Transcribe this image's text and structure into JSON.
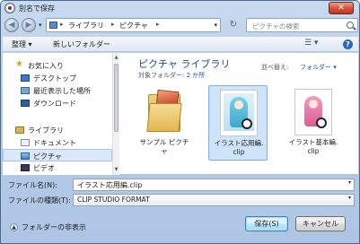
{
  "window": {
    "title": "別名で保存"
  },
  "titlebar": {
    "close_label": "✕"
  },
  "nav": {
    "back_glyph": "◀",
    "forward_glyph": "▶",
    "breadcrumb": [
      "ライブラリ",
      "ピクチャ"
    ],
    "separator": "▸",
    "dropdown_glyph": "▾",
    "refresh_glyph": "↻",
    "search_placeholder": "ピクチャの検索"
  },
  "toolbar": {
    "organize_label": "整理 ▾",
    "new_folder_label": "新しいフォルダー",
    "view_glyph": "☰ ▾",
    "help_glyph": "?"
  },
  "sidebar": {
    "items": [
      {
        "label": "お気に入り",
        "icon": "star-icon"
      },
      {
        "label": "デスクトップ",
        "icon": "desktop-icon"
      },
      {
        "label": "最近表示した場所",
        "icon": "recent-places-icon"
      },
      {
        "label": "ダウンロード",
        "icon": "downloads-icon"
      },
      {
        "label": "ライブラリ",
        "icon": "library-icon"
      },
      {
        "label": "ドキュメント",
        "icon": "documents-icon"
      },
      {
        "label": "ピクチャ",
        "icon": "pictures-icon",
        "selected": true
      },
      {
        "label": "ビデオ",
        "icon": "videos-icon"
      }
    ],
    "scroll_up": "▲",
    "scroll_down": "▼"
  },
  "content": {
    "library_title": "ピクチャ ライブラリ",
    "library_sub_prefix": "対象フォルダー: ",
    "library_sub_link": "2 か所",
    "sort_label": "並べ替え:",
    "sort_value": "フォルダー ▾",
    "files": [
      {
        "name_line1": "サンプル ピクチ",
        "name_line2": "ャ",
        "type": "folder",
        "selected": false
      },
      {
        "name_line1": "イラスト応用編.",
        "name_line2": "clip",
        "type": "clip",
        "selected": true
      },
      {
        "name_line1": "イラスト基本編.",
        "name_line2": "clip",
        "type": "clip",
        "selected": false
      }
    ]
  },
  "form": {
    "filename_label": "ファイル名(N):",
    "filename_value": "イラスト応用編.clip",
    "filetype_label": "ファイルの種類(T):",
    "filetype_value": "CLIP STUDIO FORMAT",
    "dropdown_glyph": "▾"
  },
  "footer": {
    "hide_folders_glyph": "▲",
    "hide_folders_label": "フォルダーの非表示",
    "save_label": "保存(S)",
    "cancel_label": "キャンセル"
  }
}
